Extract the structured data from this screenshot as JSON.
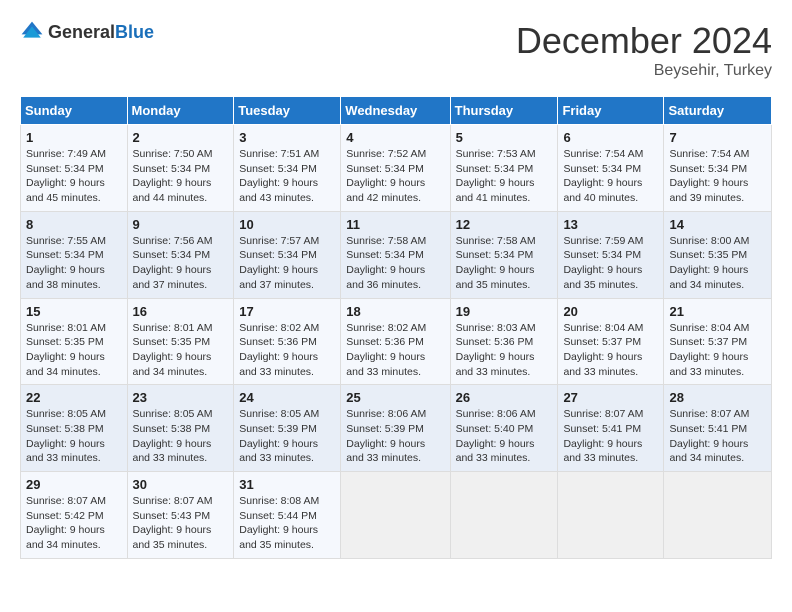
{
  "header": {
    "logo_general": "General",
    "logo_blue": "Blue",
    "title": "December 2024",
    "location": "Beysehir, Turkey"
  },
  "calendar": {
    "days_of_week": [
      "Sunday",
      "Monday",
      "Tuesday",
      "Wednesday",
      "Thursday",
      "Friday",
      "Saturday"
    ],
    "weeks": [
      [
        {
          "day": 1,
          "sunrise": "7:49 AM",
          "sunset": "5:34 PM",
          "daylight": "9 hours and 45 minutes."
        },
        {
          "day": 2,
          "sunrise": "7:50 AM",
          "sunset": "5:34 PM",
          "daylight": "9 hours and 44 minutes."
        },
        {
          "day": 3,
          "sunrise": "7:51 AM",
          "sunset": "5:34 PM",
          "daylight": "9 hours and 43 minutes."
        },
        {
          "day": 4,
          "sunrise": "7:52 AM",
          "sunset": "5:34 PM",
          "daylight": "9 hours and 42 minutes."
        },
        {
          "day": 5,
          "sunrise": "7:53 AM",
          "sunset": "5:34 PM",
          "daylight": "9 hours and 41 minutes."
        },
        {
          "day": 6,
          "sunrise": "7:54 AM",
          "sunset": "5:34 PM",
          "daylight": "9 hours and 40 minutes."
        },
        {
          "day": 7,
          "sunrise": "7:54 AM",
          "sunset": "5:34 PM",
          "daylight": "9 hours and 39 minutes."
        }
      ],
      [
        {
          "day": 8,
          "sunrise": "7:55 AM",
          "sunset": "5:34 PM",
          "daylight": "9 hours and 38 minutes."
        },
        {
          "day": 9,
          "sunrise": "7:56 AM",
          "sunset": "5:34 PM",
          "daylight": "9 hours and 37 minutes."
        },
        {
          "day": 10,
          "sunrise": "7:57 AM",
          "sunset": "5:34 PM",
          "daylight": "9 hours and 37 minutes."
        },
        {
          "day": 11,
          "sunrise": "7:58 AM",
          "sunset": "5:34 PM",
          "daylight": "9 hours and 36 minutes."
        },
        {
          "day": 12,
          "sunrise": "7:58 AM",
          "sunset": "5:34 PM",
          "daylight": "9 hours and 35 minutes."
        },
        {
          "day": 13,
          "sunrise": "7:59 AM",
          "sunset": "5:34 PM",
          "daylight": "9 hours and 35 minutes."
        },
        {
          "day": 14,
          "sunrise": "8:00 AM",
          "sunset": "5:35 PM",
          "daylight": "9 hours and 34 minutes."
        }
      ],
      [
        {
          "day": 15,
          "sunrise": "8:01 AM",
          "sunset": "5:35 PM",
          "daylight": "9 hours and 34 minutes."
        },
        {
          "day": 16,
          "sunrise": "8:01 AM",
          "sunset": "5:35 PM",
          "daylight": "9 hours and 34 minutes."
        },
        {
          "day": 17,
          "sunrise": "8:02 AM",
          "sunset": "5:36 PM",
          "daylight": "9 hours and 33 minutes."
        },
        {
          "day": 18,
          "sunrise": "8:02 AM",
          "sunset": "5:36 PM",
          "daylight": "9 hours and 33 minutes."
        },
        {
          "day": 19,
          "sunrise": "8:03 AM",
          "sunset": "5:36 PM",
          "daylight": "9 hours and 33 minutes."
        },
        {
          "day": 20,
          "sunrise": "8:04 AM",
          "sunset": "5:37 PM",
          "daylight": "9 hours and 33 minutes."
        },
        {
          "day": 21,
          "sunrise": "8:04 AM",
          "sunset": "5:37 PM",
          "daylight": "9 hours and 33 minutes."
        }
      ],
      [
        {
          "day": 22,
          "sunrise": "8:05 AM",
          "sunset": "5:38 PM",
          "daylight": "9 hours and 33 minutes."
        },
        {
          "day": 23,
          "sunrise": "8:05 AM",
          "sunset": "5:38 PM",
          "daylight": "9 hours and 33 minutes."
        },
        {
          "day": 24,
          "sunrise": "8:05 AM",
          "sunset": "5:39 PM",
          "daylight": "9 hours and 33 minutes."
        },
        {
          "day": 25,
          "sunrise": "8:06 AM",
          "sunset": "5:39 PM",
          "daylight": "9 hours and 33 minutes."
        },
        {
          "day": 26,
          "sunrise": "8:06 AM",
          "sunset": "5:40 PM",
          "daylight": "9 hours and 33 minutes."
        },
        {
          "day": 27,
          "sunrise": "8:07 AM",
          "sunset": "5:41 PM",
          "daylight": "9 hours and 33 minutes."
        },
        {
          "day": 28,
          "sunrise": "8:07 AM",
          "sunset": "5:41 PM",
          "daylight": "9 hours and 34 minutes."
        }
      ],
      [
        {
          "day": 29,
          "sunrise": "8:07 AM",
          "sunset": "5:42 PM",
          "daylight": "9 hours and 34 minutes."
        },
        {
          "day": 30,
          "sunrise": "8:07 AM",
          "sunset": "5:43 PM",
          "daylight": "9 hours and 35 minutes."
        },
        {
          "day": 31,
          "sunrise": "8:08 AM",
          "sunset": "5:44 PM",
          "daylight": "9 hours and 35 minutes."
        },
        null,
        null,
        null,
        null
      ]
    ]
  }
}
